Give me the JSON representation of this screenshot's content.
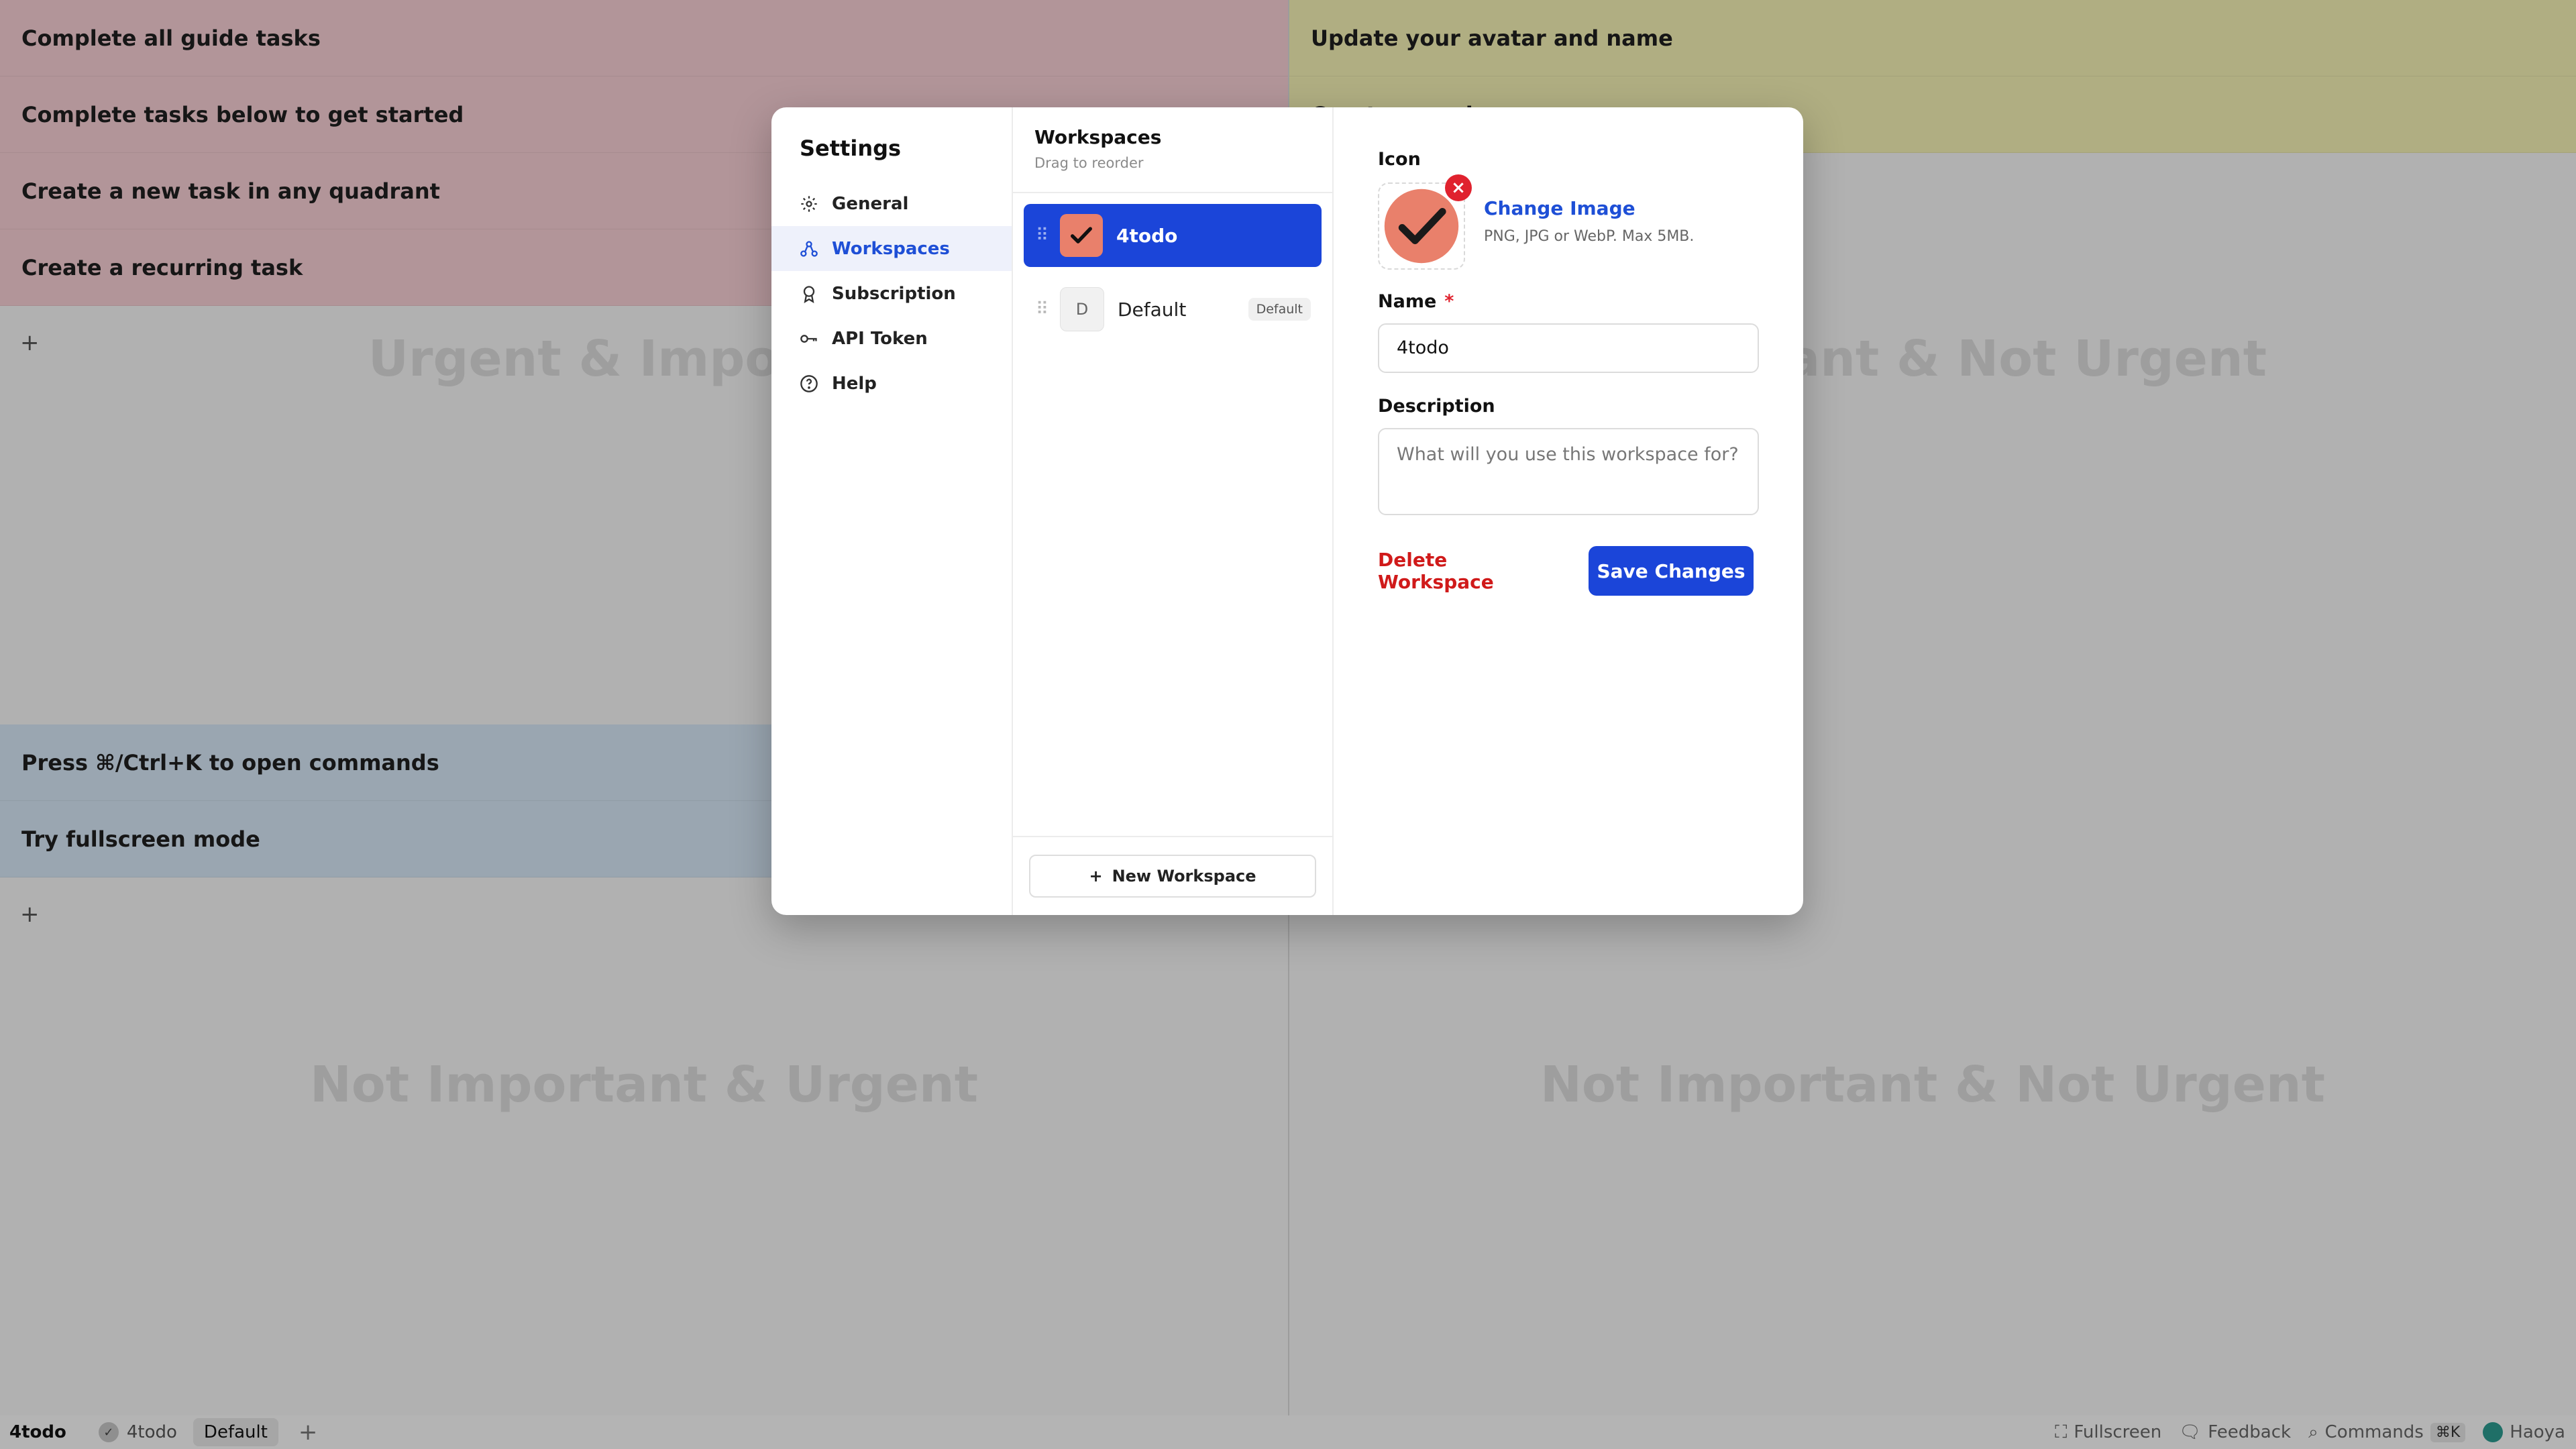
{
  "quadrants": {
    "urgent_important": {
      "label": "Urgent & Important",
      "tasks": [
        "Complete all guide tasks",
        "Complete tasks below to get started",
        "Create a new task in any quadrant",
        "Create a recurring task"
      ],
      "add": "+"
    },
    "important_not_urgent": {
      "label": "Important & Not Urgent",
      "tasks": [
        "Update your avatar and name",
        "Create a workspace"
      ],
      "add": "+"
    },
    "not_important_urgent": {
      "label": "Not Important & Urgent",
      "tasks": [
        "Press ⌘/Ctrl+K to open commands",
        "Try fullscreen mode"
      ],
      "add": "+"
    },
    "not_important_not_urgent": {
      "label": "Not Important & Not Urgent"
    }
  },
  "bottombar": {
    "app_name": "4todo",
    "workspace_name": "4todo",
    "default_chip": "Default",
    "add": "+",
    "fullscreen": "Fullscreen",
    "feedback": "Feedback",
    "commands": "Commands",
    "commands_kbd": "⌘K",
    "user": "Haoya"
  },
  "settings": {
    "title": "Settings",
    "nav": [
      {
        "label": "General",
        "icon": "gear-icon"
      },
      {
        "label": "Workspaces",
        "icon": "workspaces-icon"
      },
      {
        "label": "Subscription",
        "icon": "badge-icon"
      },
      {
        "label": "API Token",
        "icon": "key-icon"
      },
      {
        "label": "Help",
        "icon": "help-icon"
      }
    ],
    "active_nav": "Workspaces"
  },
  "workspaces": {
    "title": "Workspaces",
    "subtitle": "Drag to reorder",
    "items": [
      {
        "name": "4todo",
        "icon": "checkmark-image",
        "active": true
      },
      {
        "name": "Default",
        "letter": "D",
        "badge": "Default",
        "active": false
      }
    ],
    "new_button": "New Workspace"
  },
  "detail": {
    "icon_label": "Icon",
    "change_image": "Change Image",
    "image_hint": "PNG, JPG or WebP. Max 5MB.",
    "name_label": "Name",
    "required_mark": "*",
    "name_value": "4todo",
    "description_label": "Description",
    "description_placeholder": "What will you use this workspace for?",
    "delete_button": "Delete Workspace",
    "save_button": "Save Changes"
  },
  "colors": {
    "accent": "#1b45d9",
    "danger": "#d01a1a",
    "q1_task": "#f7cfd4",
    "q2_task": "#f4f1b4",
    "q3_task": "#d6e6f6"
  }
}
